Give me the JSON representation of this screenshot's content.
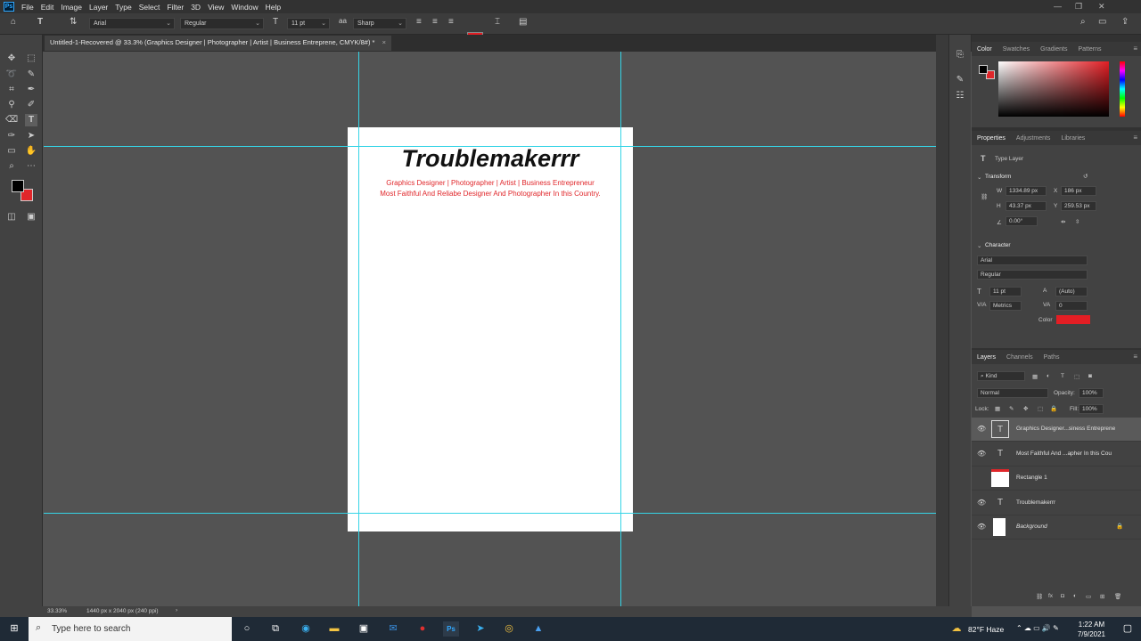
{
  "menubar": {
    "app_badge": "Ps",
    "items": [
      "File",
      "Edit",
      "Image",
      "Layer",
      "Type",
      "Select",
      "Filter",
      "3D",
      "View",
      "Window",
      "Help"
    ]
  },
  "options": {
    "font_family": "Arial",
    "font_style": "Regular",
    "font_size": "11 pt",
    "anti_alias": "Sharp",
    "text_color": "#e31e24"
  },
  "document": {
    "tab_title": "Untitled-1-Recovered @ 33.3% (Graphics Designer | Photographer | Artist | Business Entreprene, CMYK/8#) *",
    "title": "Troublemakerrr",
    "subtitle": "Graphics Designer | Photographer | Artist | Business Entrepreneur",
    "tagline": "Most Faithful And Reliabe Designer And Photographer In this Country."
  },
  "color_panel": {
    "tabs": [
      "Color",
      "Swatches",
      "Gradients",
      "Patterns"
    ],
    "foreground": "#000000",
    "background": "#e0262a"
  },
  "properties_panel": {
    "tabs": [
      "Properties",
      "Adjustments",
      "Libraries"
    ],
    "layer_kind": "Type Layer",
    "transform_label": "Transform",
    "w_label": "W",
    "w": "1334.89 px",
    "h_label": "H",
    "h": "43.37 px",
    "x_label": "X",
    "x": "186 px",
    "y_label": "Y",
    "y": "259.53 px",
    "angle": "0.00°",
    "character_label": "Character",
    "font": "Arial",
    "style": "Regular",
    "size": "11 pt",
    "leading": "(Auto)",
    "kerning": "Metrics",
    "tracking": "0",
    "color_label": "Color",
    "color": "#e31e24"
  },
  "layers_panel": {
    "tabs": [
      "Layers",
      "Channels",
      "Paths"
    ],
    "filter": "Kind",
    "blend_mode": "Normal",
    "opacity_label": "Opacity:",
    "opacity": "100%",
    "lock_label": "Lock:",
    "fill_label": "Fill:",
    "fill": "100%",
    "layers": [
      {
        "name": "Graphics Designer...siness Entreprene",
        "kind": "T"
      },
      {
        "name": "Most Faithful And ...apher In this Cou",
        "kind": "T"
      },
      {
        "name": "Rectangle 1",
        "kind": "R"
      },
      {
        "name": "Troublemakerrr",
        "kind": "T"
      },
      {
        "name": "Background",
        "kind": "B"
      }
    ]
  },
  "status": {
    "zoom": "33.33%",
    "doc_info": "1440 px x 2040 px (240 ppi)"
  },
  "taskbar": {
    "search_placeholder": "Type here to search",
    "weather": "82°F Haze",
    "time": "1:22 AM",
    "date": "7/9/2021"
  }
}
